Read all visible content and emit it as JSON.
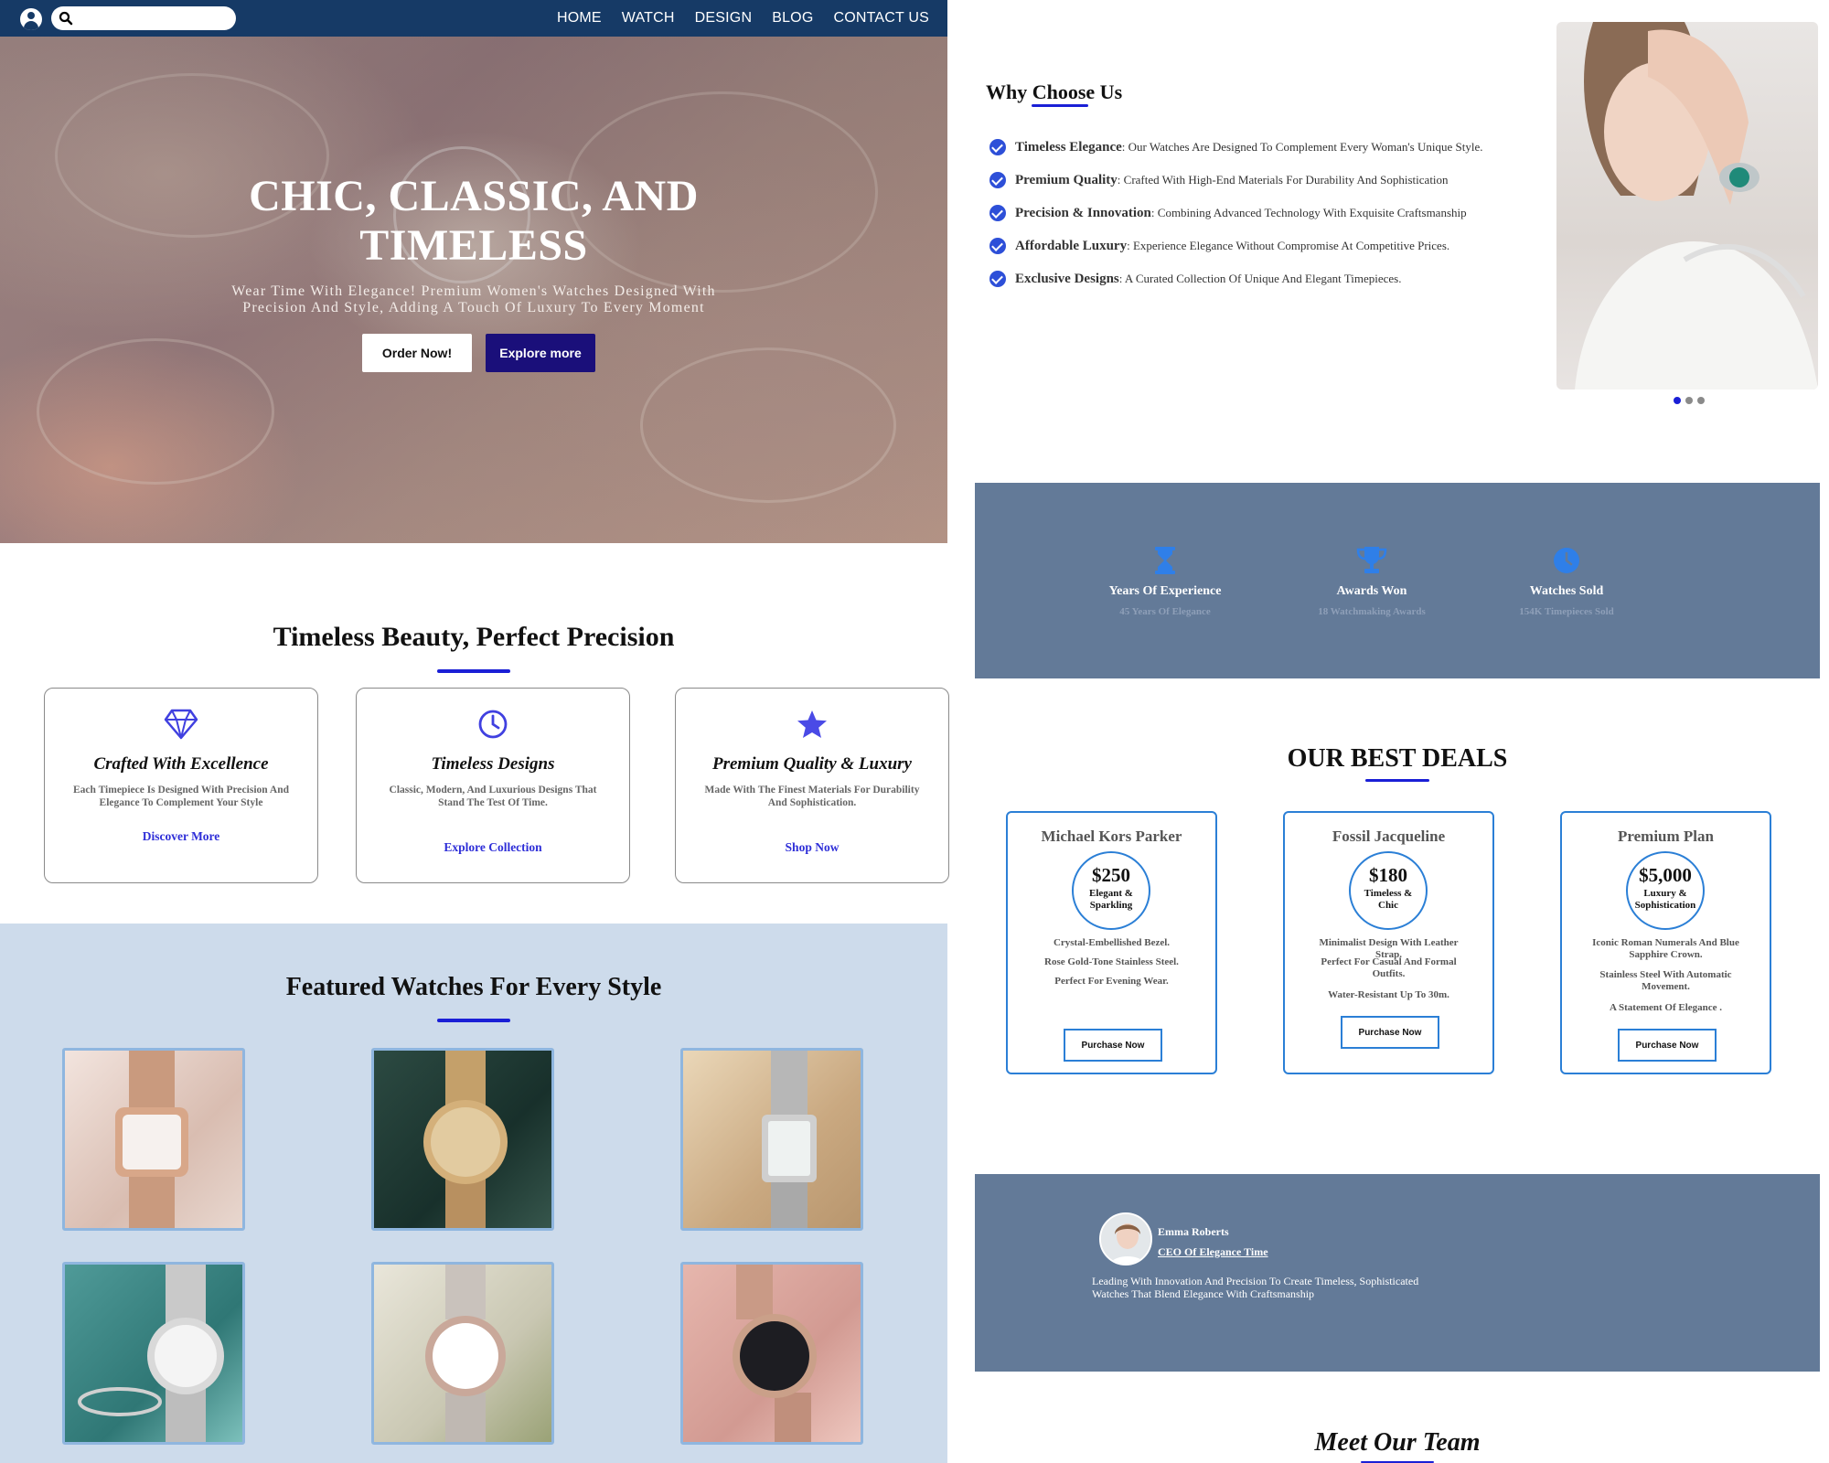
{
  "nav": {
    "search_placeholder": "",
    "links": [
      "HOME",
      "WATCH",
      "DESIGN",
      "BLOG",
      "CONTACT US"
    ],
    "bg_color": "#163a66"
  },
  "hero": {
    "title_line1": "CHIC, CLASSIC, AND",
    "title_line2": "TIMELESS",
    "subtitle_line1": "Wear Time With Elegance! Premium Women's Watches Designed With",
    "subtitle_line2": "Precision And Style, Adding A Touch Of Luxury To Every Moment",
    "order_button": "Order Now!",
    "explore_button": "Explore more"
  },
  "beauty": {
    "title": "Timeless Beauty, Perfect Precision",
    "cards": [
      {
        "icon": "diamond-icon",
        "title": "Crafted With Excellence",
        "desc": "Each Timepiece Is Designed With Precision And Elegance To Complement Your Style",
        "link": "Discover More"
      },
      {
        "icon": "clock-icon",
        "title": "Timeless Designs",
        "desc": "Classic, Modern, And Luxurious Designs That Stand The Test Of Time.",
        "link": "Explore Collection"
      },
      {
        "icon": "star-icon",
        "title": "Premium Quality & Luxury",
        "desc": "Made With The Finest Materials For Durability And Sophistication.",
        "link": "Shop Now"
      }
    ]
  },
  "featured": {
    "title": "Featured Watches For Every Style"
  },
  "why": {
    "title": "Why Choose Us",
    "items": [
      {
        "bold": "Timeless Elegance",
        "text": ": Our Watches Are Designed To Complement Every Woman's Unique Style."
      },
      {
        "bold": "Premium Quality",
        "text": " : Crafted With High-End Materials For Durability And Sophistication"
      },
      {
        "bold": "Precision & Innovation",
        "text": ": Combining Advanced Technology With Exquisite Craftsmanship"
      },
      {
        "bold": "Affordable Luxury",
        "text": ": Experience Elegance Without Compromise At Competitive Prices."
      },
      {
        "bold": "Exclusive Designs",
        "text": ": A Curated Collection Of Unique And Elegant Timepieces."
      }
    ]
  },
  "stats": [
    {
      "icon": "hourglass-icon",
      "label": "Years Of Experience",
      "sub": "45 Years Of Elegance"
    },
    {
      "icon": "trophy-icon",
      "label": "Awards Won",
      "sub": "18 Watchmaking Awards"
    },
    {
      "icon": "clock-icon",
      "label": "Watches Sold",
      "sub": "154K Timepieces Sold"
    }
  ],
  "deals": {
    "title": "OUR BEST DEALS",
    "cards": [
      {
        "name": "Michael Kors Parker",
        "price": "$250",
        "tag": "Elegant & Sparkling",
        "features": [
          "Crystal-Embellished Bezel.",
          "Rose Gold-Tone Stainless Steel.",
          "Perfect For Evening Wear."
        ],
        "button": "Purchase Now"
      },
      {
        "name": "Fossil Jacqueline",
        "price": "$180",
        "tag": "Timeless & Chic",
        "features": [
          "Minimalist Design With Leather Strap.",
          "Perfect For Casual And Formal Outfits.",
          "Water-Resistant Up To 30m."
        ],
        "button": "Purchase Now"
      },
      {
        "name": "Premium Plan",
        "price": "$5,000",
        "tag": "Luxury & Sophistication",
        "features": [
          "Iconic Roman Numerals And Blue Sapphire Crown.",
          "Stainless Steel With Automatic Movement.",
          "A Statement Of Elegance ."
        ],
        "button": "Purchase Now"
      }
    ]
  },
  "testimonial": {
    "name": "Emma Roberts",
    "role": "CEO Of Elegance Time",
    "quote": "Leading With Innovation And Precision To Create Timeless, Sophisticated Watches That Blend Elegance With Craftsmanship"
  },
  "team": {
    "title": "Meet Our Team"
  },
  "colors": {
    "accent": "#1a1fd6",
    "explore_button": "#1a0f7a",
    "stats_bg": "#637a98",
    "featured_bg": "#cddbeb",
    "deal_border": "#2b7fd6"
  }
}
